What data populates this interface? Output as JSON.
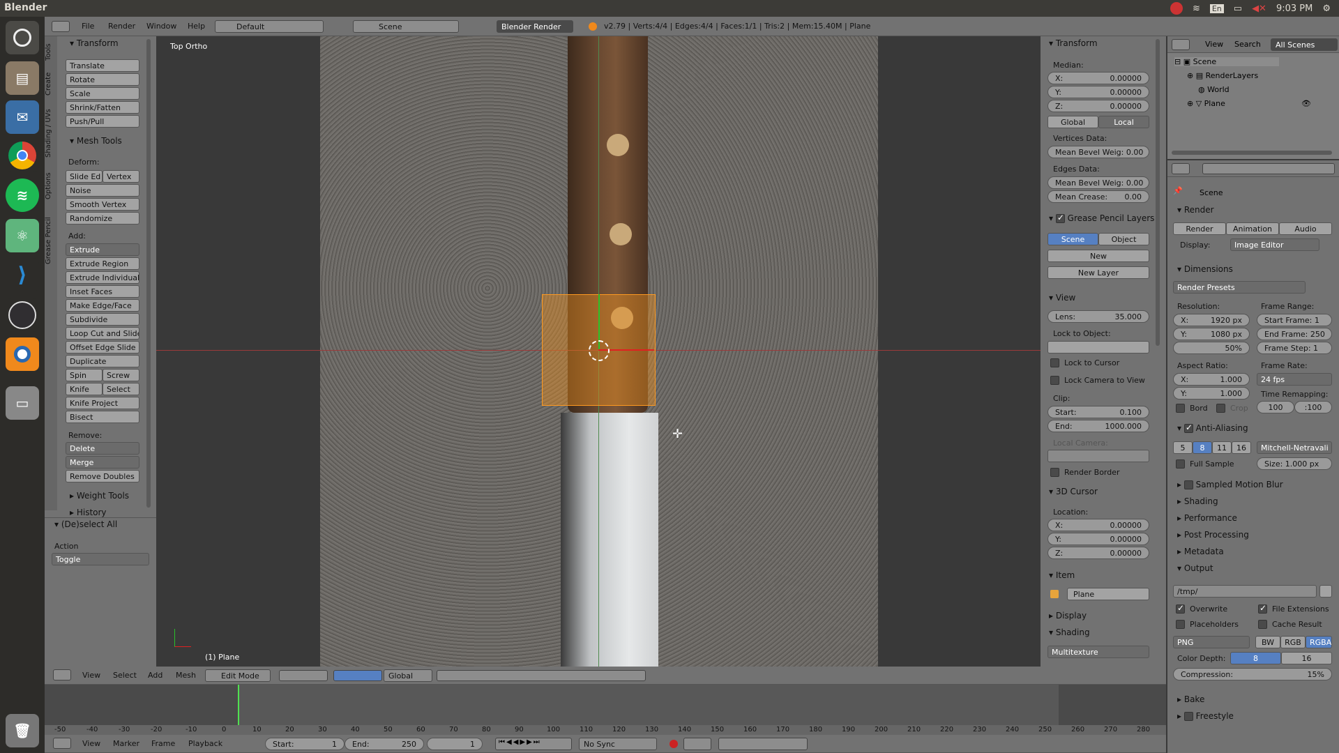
{
  "os": {
    "app_title": "Blender",
    "lang": "En",
    "clock": "9:03 PM"
  },
  "topbar": {
    "menus": [
      "File",
      "Render",
      "Window",
      "Help"
    ],
    "layout": "Default",
    "scene": "Scene",
    "engine": "Blender Render",
    "stats": "v2.79 | Verts:4/4 | Edges:4/4 | Faces:1/1 | Tris:2 | Mem:15.40M | Plane"
  },
  "toolshelf": {
    "tabs": [
      "Tools",
      "Create",
      "Shading / UVs",
      "Options",
      "Grease Pencil"
    ],
    "transform_title": "Transform",
    "transform": [
      "Translate",
      "Rotate",
      "Scale",
      "Shrink/Fatten",
      "Push/Pull"
    ],
    "mesh_tools_title": "Mesh Tools",
    "deform_label": "Deform:",
    "slide_edge": "Slide Ed",
    "vertex": "Vertex",
    "noise": "Noise",
    "smooth_vertex": "Smooth Vertex",
    "randomize": "Randomize",
    "add_label": "Add:",
    "extrude": "Extrude",
    "add_items": [
      "Extrude Region",
      "Extrude Individual",
      "Inset Faces",
      "Make Edge/Face",
      "Subdivide",
      "Loop Cut and Slide",
      "Offset Edge Slide",
      "Duplicate"
    ],
    "spin": "Spin",
    "screw": "Screw",
    "knife": "Knife",
    "select": "Select",
    "knife_project": "Knife Project",
    "bisect": "Bisect",
    "remove_label": "Remove:",
    "delete": "Delete",
    "merge": "Merge",
    "remove_doubles": "Remove Doubles",
    "weight_tools": "Weight Tools",
    "history": "History",
    "operator_title": "(De)select All",
    "action_label": "Action",
    "action_value": "Toggle"
  },
  "viewport": {
    "view_label": "Top Ortho",
    "object_label": "(1) Plane"
  },
  "npanel": {
    "transform_title": "Transform",
    "median_label": "Median:",
    "median": [
      {
        "axis": "X:",
        "value": "0.00000"
      },
      {
        "axis": "Y:",
        "value": "0.00000"
      },
      {
        "axis": "Z:",
        "value": "0.00000"
      }
    ],
    "global": "Global",
    "local": "Local",
    "vertices_data": "Vertices Data:",
    "mean_bevel_weight_v": "Mean Bevel Weig: 0.00",
    "edges_data": "Edges Data:",
    "mean_bevel_weight_e": "Mean Bevel Weig: 0.00",
    "mean_crease": "Mean Crease:",
    "mean_crease_val": "0.00",
    "gp_layers": "Grease Pencil Layers",
    "scene": "Scene",
    "object": "Object",
    "new": "New",
    "new_layer": "New Layer",
    "view_title": "View",
    "lens_label": "Lens:",
    "lens_value": "35.000",
    "lock_to_object": "Lock to Object:",
    "lock_to_cursor": "Lock to Cursor",
    "lock_camera": "Lock Camera to View",
    "clip_label": "Clip:",
    "clip_start_label": "Start:",
    "clip_start": "0.100",
    "clip_end_label": "End:",
    "clip_end": "1000.000",
    "local_camera": "Local Camera:",
    "render_border": "Render Border",
    "cursor_title": "3D Cursor",
    "location_label": "Location:",
    "cursor": [
      {
        "axis": "X:",
        "value": "0.00000"
      },
      {
        "axis": "Y:",
        "value": "0.00000"
      },
      {
        "axis": "Z:",
        "value": "0.00000"
      }
    ],
    "item_title": "Item",
    "item_name": "Plane",
    "display_title": "Display",
    "shading_title": "Shading",
    "shading_value": "Multitexture"
  },
  "outliner": {
    "menus": [
      "View",
      "Search"
    ],
    "filter": "All Scenes",
    "items": [
      "Scene",
      "RenderLayers",
      "World",
      "Plane"
    ]
  },
  "properties": {
    "context": "Scene",
    "render_title": "Render",
    "render_btn": "Render",
    "animation_btn": "Animation",
    "audio_btn": "Audio",
    "display_label": "Display:",
    "display_value": "Image Editor",
    "dimensions_title": "Dimensions",
    "render_presets": "Render Presets",
    "resolution_label": "Resolution:",
    "res_x_label": "X:",
    "res_x": "1920 px",
    "res_y_label": "Y:",
    "res_y": "1080 px",
    "res_pct": "50%",
    "frame_range_label": "Frame Range:",
    "start_frame": "Start Frame: 1",
    "end_frame": "End Frame: 250",
    "frame_step": "Frame Step: 1",
    "aspect_label": "Aspect Ratio:",
    "aspect_x_label": "X:",
    "aspect_x": "1.000",
    "aspect_y_label": "Y:",
    "aspect_y": "1.000",
    "frame_rate_label": "Frame Rate:",
    "fps": "24 fps",
    "time_remap_label": "Time Remapping:",
    "remap_old": "100",
    "remap_new": ":100",
    "bord": "Bord",
    "crop": "Crop",
    "aa_title": "Anti-Aliasing",
    "aa_samples": [
      "5",
      "8",
      "11",
      "16"
    ],
    "aa_filter": "Mitchell-Netravali",
    "full_sample": "Full Sample",
    "aa_size": "Size: 1.000 px",
    "sampled_motion_blur": "Sampled Motion Blur",
    "shading": "Shading",
    "performance": "Performance",
    "post_processing": "Post Processing",
    "metadata": "Metadata",
    "output_title": "Output",
    "output_path": "/tmp/",
    "overwrite": "Overwrite",
    "file_ext": "File Extensions",
    "placeholders": "Placeholders",
    "cache_result": "Cache Result",
    "format": "PNG",
    "bw": "BW",
    "rgb": "RGB",
    "rgba": "RGBA",
    "color_depth_label": "Color Depth:",
    "depth_8": "8",
    "depth_16": "16",
    "compression": "Compression:",
    "compression_val": "15%",
    "bake": "Bake",
    "freestyle": "Freestyle"
  },
  "view3d_header": {
    "menus": [
      "View",
      "Select",
      "Add",
      "Mesh"
    ],
    "mode": "Edit Mode",
    "orientation": "Global"
  },
  "timeline": {
    "ticks": [
      "-50",
      "-40",
      "-30",
      "-20",
      "-10",
      "0",
      "10",
      "20",
      "30",
      "40",
      "50",
      "60",
      "70",
      "80",
      "90",
      "100",
      "110",
      "120",
      "130",
      "140",
      "150",
      "160",
      "170",
      "180",
      "190",
      "200",
      "210",
      "220",
      "230",
      "240",
      "250",
      "260",
      "270",
      "280"
    ],
    "menus": [
      "View",
      "Marker",
      "Frame",
      "Playback"
    ],
    "start_label": "Start:",
    "start": "1",
    "end_label": "End:",
    "end": "250",
    "current": "1",
    "sync": "No Sync"
  }
}
